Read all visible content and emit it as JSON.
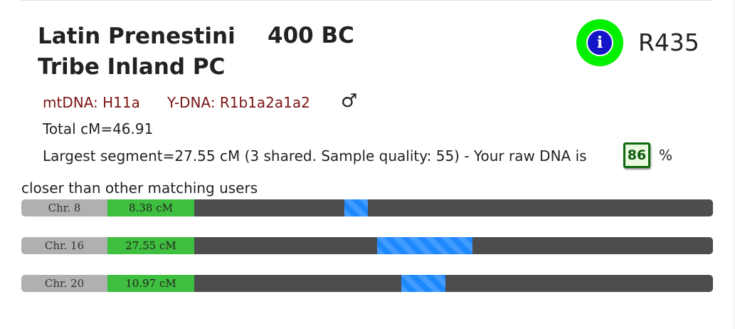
{
  "header": {
    "title_line1": "Latin Prenestini",
    "title_line2": "Tribe Inland PC",
    "era": "400 BC",
    "info_icon_glyph": "i",
    "sample_id": "R435"
  },
  "haplogroups": {
    "mtdna": "mtDNA: H11a",
    "ydna": "Y-DNA: R1b1a2a1a2",
    "sex_icon": "♂"
  },
  "stats": {
    "total": "Total cM=46.91",
    "largest": "Largest segment=27.55 cM (3 shared. Sample quality: 55) - Your raw DNA is",
    "closer_percent": "86",
    "percent_sign": "%",
    "closer_text": "closer than other matching users"
  },
  "chromosomes": [
    {
      "label": "Chr. 8",
      "cm": "8.38 cM",
      "segment_start": 0.29,
      "segment_end": 0.335
    },
    {
      "label": "Chr. 16",
      "cm": "27.55 cM",
      "segment_start": 0.352,
      "segment_end": 0.537
    },
    {
      "label": "Chr. 20",
      "cm": "10.97 cM",
      "segment_start": 0.399,
      "segment_end": 0.484
    }
  ],
  "colors": {
    "info_outer": "#00f000",
    "info_inner": "#1515c8",
    "haplogroup_text": "#7a1414",
    "cm_fill": "#3fbf3f",
    "segment": "#1e88ff",
    "track": "#4d4d4d",
    "label_bg": "#b0b0b0"
  }
}
